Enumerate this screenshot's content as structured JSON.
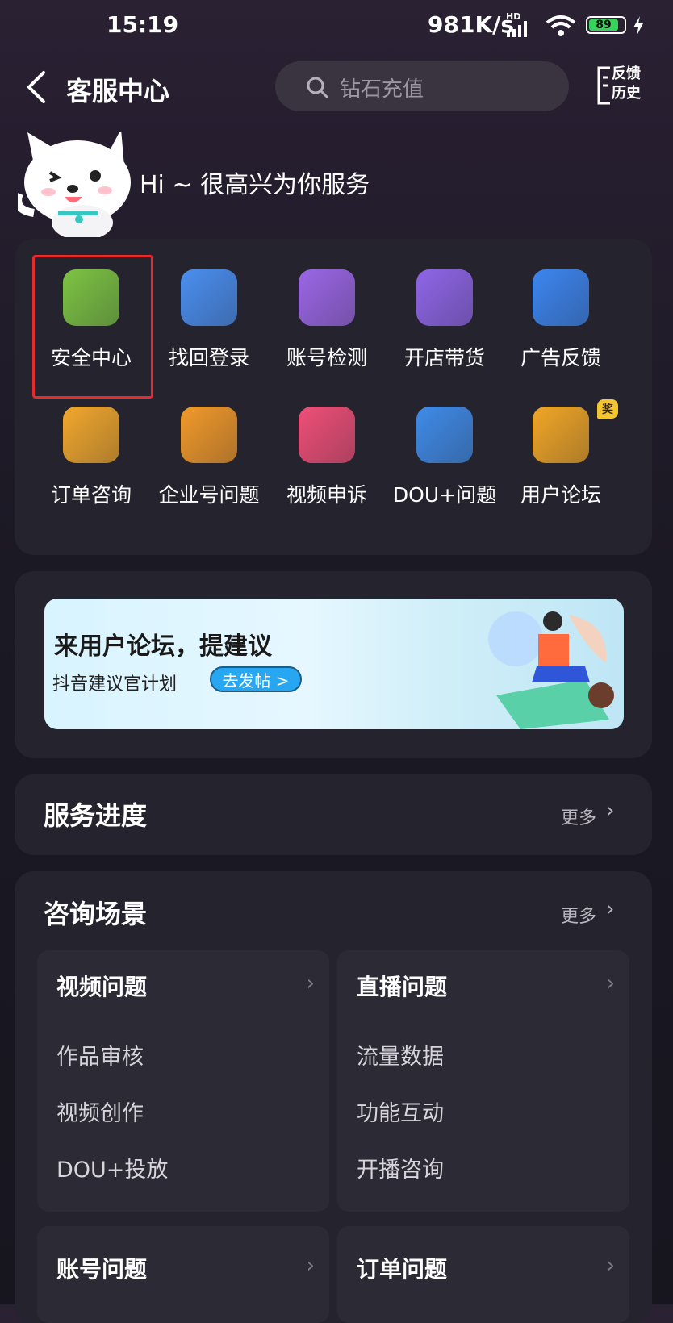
{
  "status_bar": {
    "time": "15:19",
    "net_speed": "981K/s",
    "hd": "HD",
    "battery": "89"
  },
  "header": {
    "title": "客服中心",
    "search_placeholder": "钻石充值",
    "feedback_line1": "反馈",
    "feedback_line2": "历史"
  },
  "greeting": "Hi ~  很高兴为你服务",
  "grid": [
    {
      "label": "安全中心",
      "icon": "shield-check-icon",
      "color": "#7cc443"
    },
    {
      "label": "找回登录",
      "icon": "lock-search-icon",
      "color": "#4a8ff0"
    },
    {
      "label": "账号检测",
      "icon": "pulse-check-icon",
      "color": "#9b67e6"
    },
    {
      "label": "开店带货",
      "icon": "user-shop-icon",
      "color": "#8f66e8"
    },
    {
      "label": "广告反馈",
      "icon": "ad-edit-icon",
      "color": "#3c86f0"
    },
    {
      "label": "订单咨询",
      "icon": "shopping-bag-icon",
      "color": "#f2a82d"
    },
    {
      "label": "企业号问题",
      "icon": "enterprise-hex-icon",
      "color": "#f29a2a"
    },
    {
      "label": "视频申诉",
      "icon": "video-play-icon",
      "color": "#ef4f78"
    },
    {
      "label": "DOU+问题",
      "icon": "dou-plus-icon",
      "color": "#3f8be8"
    },
    {
      "label": "用户论坛",
      "icon": "chat-bubble-icon",
      "color": "#f1a726"
    }
  ],
  "forum_badge": "奖",
  "banner": {
    "headline": "来用户论坛，提建议",
    "subline": "抖音建议官计划",
    "button": "去发帖 >"
  },
  "progress": {
    "title": "服务进度",
    "more": "更多"
  },
  "consult": {
    "title": "咨询场景",
    "more": "更多",
    "categories": [
      {
        "title": "视频问题",
        "items": [
          "作品审核",
          "视频创作",
          "DOU+投放"
        ]
      },
      {
        "title": "直播问题",
        "items": [
          "流量数据",
          "功能互动",
          "开播咨询"
        ]
      },
      {
        "title": "账号问题",
        "items": []
      },
      {
        "title": "订单问题",
        "items": []
      }
    ]
  }
}
